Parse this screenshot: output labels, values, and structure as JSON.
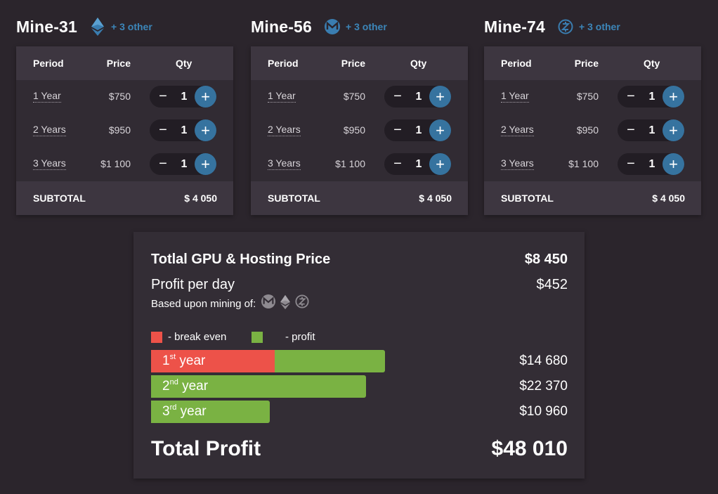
{
  "colors": {
    "background": "#2b252c",
    "card": "#312b33",
    "card_header": "#3d3640",
    "accent_blue": "#36739f",
    "break_even": "#ed5249",
    "profit": "#7ab243"
  },
  "table_headers": {
    "period": "Period",
    "price": "Price",
    "qty": "Qty"
  },
  "miners": [
    {
      "name": "Mine-31",
      "coin_icon": "ethereum-icon",
      "other": "+ 3 other",
      "rows": [
        {
          "period": "1 Year",
          "price": "$750",
          "qty": "1"
        },
        {
          "period": "2 Years",
          "price": "$950",
          "qty": "1"
        },
        {
          "period": "3 Years",
          "price": "$1 100",
          "qty": "1"
        }
      ],
      "subtotal_label": "SUBTOTAL",
      "subtotal": "$ 4 050"
    },
    {
      "name": "Mine-56",
      "coin_icon": "monero-icon",
      "other": "+ 3 other",
      "rows": [
        {
          "period": "1 Year",
          "price": "$750",
          "qty": "1"
        },
        {
          "period": "2 Years",
          "price": "$950",
          "qty": "1"
        },
        {
          "period": "3 Years",
          "price": "$1 100",
          "qty": "1"
        }
      ],
      "subtotal_label": "SUBTOTAL",
      "subtotal": "$ 4 050"
    },
    {
      "name": "Mine-74",
      "coin_icon": "zcash-icon",
      "other": "+ 3 other",
      "rows": [
        {
          "period": "1 Year",
          "price": "$750",
          "qty": "1"
        },
        {
          "period": "2 Years",
          "price": "$950",
          "qty": "1"
        },
        {
          "period": "3 Years",
          "price": "$1 100",
          "qty": "1"
        }
      ],
      "subtotal_label": "SUBTOTAL",
      "subtotal": "$ 4 050"
    }
  ],
  "summary": {
    "total_price_label": "Totlal GPU & Hosting Price",
    "total_price": "$8 450",
    "profit_day_label": "Profit per day",
    "profit_day": "$452",
    "based_on_label": "Based upon mining of:",
    "based_on_icons": [
      "monero-icon",
      "ethereum-icon",
      "zcash-icon"
    ],
    "legend_break_even": "- break even",
    "legend_profit": "- profit",
    "years": [
      {
        "ordinal": "1",
        "suffix": "st",
        "word": "year",
        "value": "$14 680",
        "bar_fraction": 0.561,
        "break_even_fraction": 0.296
      },
      {
        "ordinal": "2",
        "suffix": "nd",
        "word": "year",
        "value": "$22 370",
        "bar_fraction": 0.516,
        "break_even_fraction": 0
      },
      {
        "ordinal": "3",
        "suffix": "rd",
        "word": "year",
        "value": "$10 960",
        "bar_fraction": 0.285,
        "break_even_fraction": 0
      }
    ],
    "total_profit_label": "Total Profit",
    "total_profit": "$48 010"
  }
}
